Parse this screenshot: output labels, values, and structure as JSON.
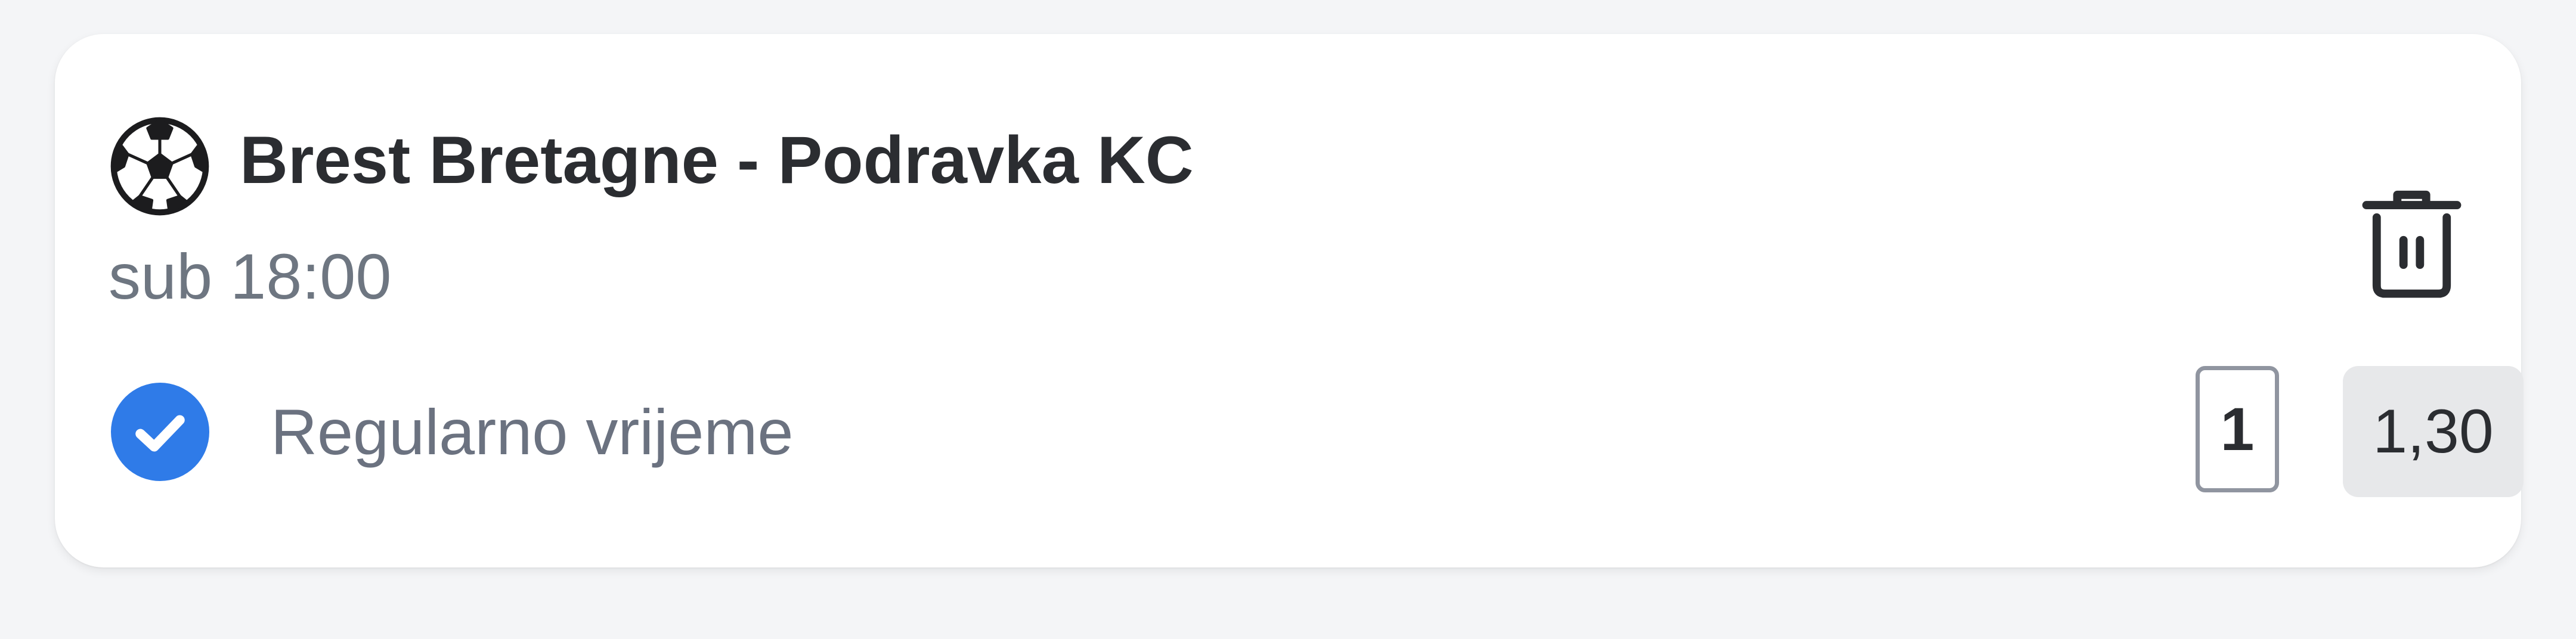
{
  "bet": {
    "sport_icon": "soccer-ball-icon",
    "match_title": "Brest Bretagne - Podravka KC",
    "time": "sub 18:00",
    "market": "Regularno vrijeme",
    "pick": "1",
    "odds": "1,30",
    "selected": true,
    "remove_icon": "trash-icon"
  },
  "colors": {
    "background": "#f4f5f7",
    "card": "#ffffff",
    "check_accent": "#2f7be8",
    "odds_bg": "#e7e8ea",
    "title_text": "#2b2d31",
    "secondary_text": "#6e7681"
  }
}
